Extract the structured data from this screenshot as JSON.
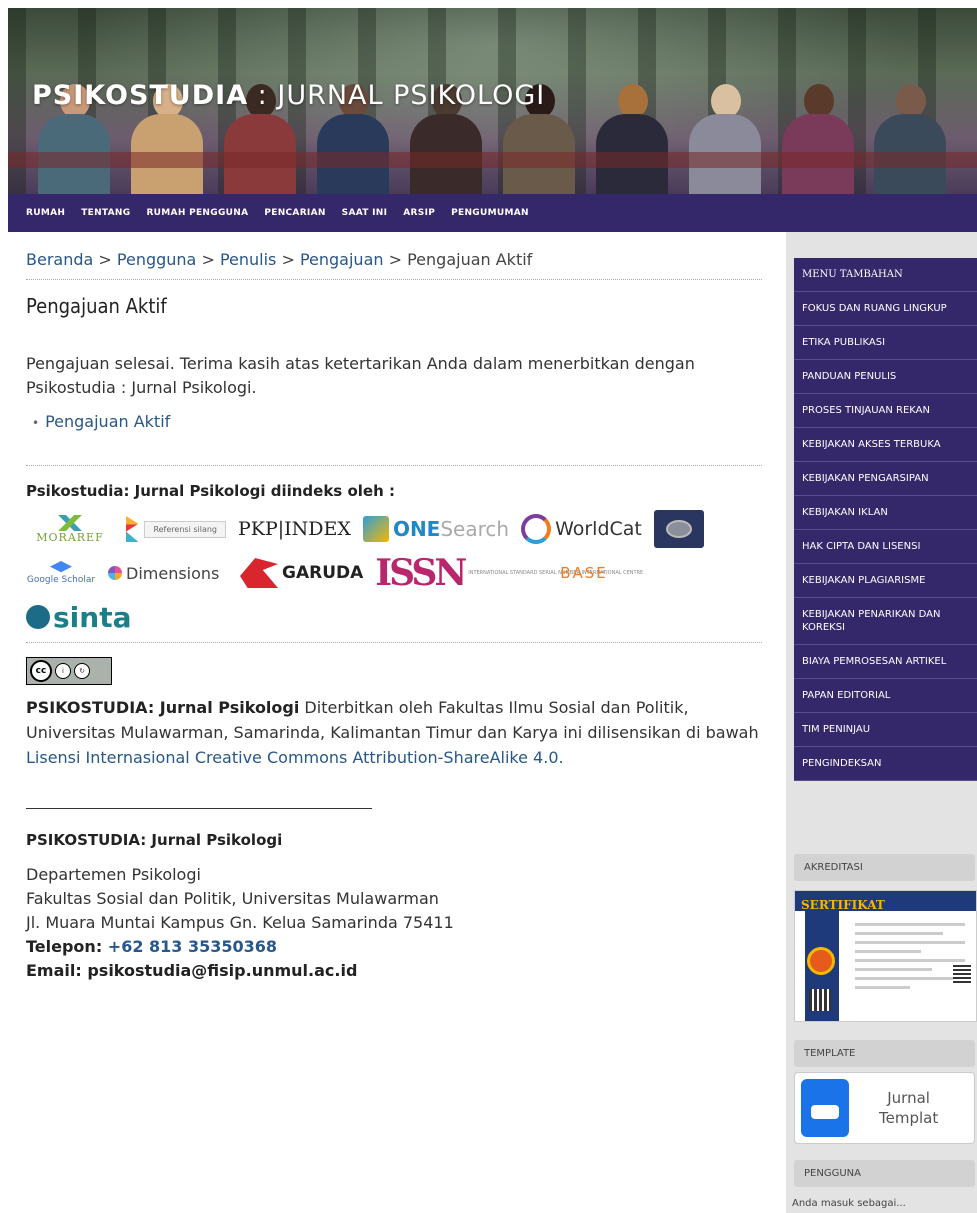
{
  "header": {
    "title_bold": "PSIKOSTUDIA",
    "title_light": " : JURNAL PSIKOLOGI"
  },
  "nav": {
    "items": [
      "RUMAH",
      "TENTANG",
      "RUMAH PENGGUNA",
      "PENCARIAN",
      "SAAT INI",
      "ARSIP",
      "PENGUMUMAN"
    ]
  },
  "breadcrumb": {
    "items": [
      "Beranda",
      "Pengguna",
      "Penulis",
      "Pengajuan"
    ],
    "current": "Pengajuan Aktif",
    "separator": " > "
  },
  "main": {
    "title": "Pengajuan Aktif",
    "intro": "Pengajuan selesai. Terima kasih atas ketertarikan Anda dalam menerbitkan dengan Psikostudia : Jurnal Psikologi.",
    "link": "Pengajuan Aktif",
    "indexed_title": "Psikostudia: Jurnal Psikologi diindeks oleh :",
    "logos": {
      "moraref": "MORAREF",
      "crossref": "Referensi silang",
      "pkp": "PKP|INDEX",
      "onesearch_prefix": "ONE",
      "onesearch_suffix": "Search",
      "worldcat": "WorldCat",
      "gscholar": "Google Scholar",
      "dimensions": "Dimensions",
      "garuda": "GARUDA",
      "issn": "ISSN",
      "issn_text": "INTERNATIONAL STANDARD SERIAL NUMBER INTERNATIONAL CENTRE",
      "base": "BASE",
      "sinta": "sinta"
    },
    "license_bold": "PSIKOSTUDIA: Jurnal Psikologi",
    "license_text": " Diterbitkan oleh Fakultas Ilmu Sosial dan Politik, Universitas Mulawarman, Samarinda, Kalimantan Timur dan Karya ini dilisensikan di bawah ",
    "license_link": "Lisensi Internasional Creative Commons Attribution-ShareAlike 4.0.",
    "footer_title": "PSIKOSTUDIA: Jurnal Psikologi",
    "address_lines": [
      "Departemen Psikologi",
      "Fakultas Sosial dan Politik, Universitas Mulawarman",
      "Jl. Muara Muntai Kampus Gn. Kelua Samarinda 75411"
    ],
    "phone_label": "Telepon: ",
    "phone": "+62 813 35350368",
    "email": "Email: psikostudia@fisip.unmul.ac.id"
  },
  "sidebar": {
    "menu": [
      "MENU TAMBAHAN",
      "FOKUS DAN RUANG LINGKUP",
      "ETIKA PUBLIKASI",
      "PANDUAN PENULIS",
      "PROSES TINJAUAN REKAN",
      "KEBIJAKAN AKSES TERBUKA",
      "KEBIJAKAN PENGARSIPAN",
      "KEBIJAKAN IKLAN",
      "HAK CIPTA DAN LISENSI",
      "KEBIJAKAN PLAGIARISME",
      "KEBIJAKAN PENARIKAN DAN KOREKSI",
      "BIAYA PEMROSESAN ARTIKEL",
      "PAPAN EDITORIAL",
      "TIM PENINJAU",
      "PENGINDEKSAN"
    ],
    "akreditasi_title": "AKREDITASI",
    "certificate_title": "SERTIFIKAT",
    "template_title": "TEMPLATE",
    "template_line1": "Jurnal",
    "template_line2": "Templat",
    "pengguna_title": "PENGGUNA",
    "signed_in": "Anda masuk sebagai..."
  },
  "colors": {
    "nav_bg": "#35286a",
    "link": "#28578a"
  }
}
